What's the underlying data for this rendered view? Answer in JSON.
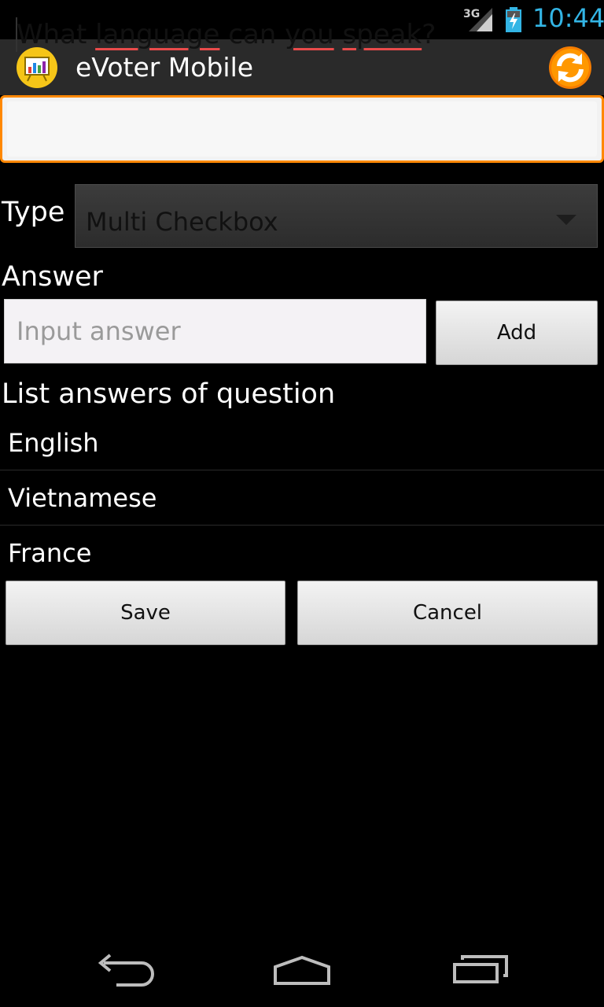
{
  "status_bar": {
    "network": "3G",
    "time": "10:44",
    "icons": [
      "signal-icon",
      "battery-charging-icon"
    ]
  },
  "action_bar": {
    "title": "eVoter Mobile",
    "icons": [
      "app-logo-icon",
      "refresh-icon"
    ]
  },
  "question": {
    "text_parts": [
      "What ",
      "language",
      " can ",
      "you",
      " ",
      "speak",
      "?"
    ]
  },
  "type_row": {
    "label": "Type",
    "selected": "Multi Checkbox"
  },
  "answer_row": {
    "label": "Answer",
    "placeholder": "Input answer",
    "value": "",
    "add_label": "Add"
  },
  "answers": {
    "title": "List answers of question",
    "items": [
      "English",
      "Vietnamese",
      "France"
    ]
  },
  "actions": {
    "save_label": "Save",
    "cancel_label": "Cancel"
  },
  "nav_bar": {
    "icons": [
      "back-icon",
      "home-icon",
      "recent-apps-icon"
    ]
  },
  "colors": {
    "accent_orange": "#ff8800",
    "clock_blue": "#33b5e5",
    "spell_red": "#e94b4b"
  }
}
